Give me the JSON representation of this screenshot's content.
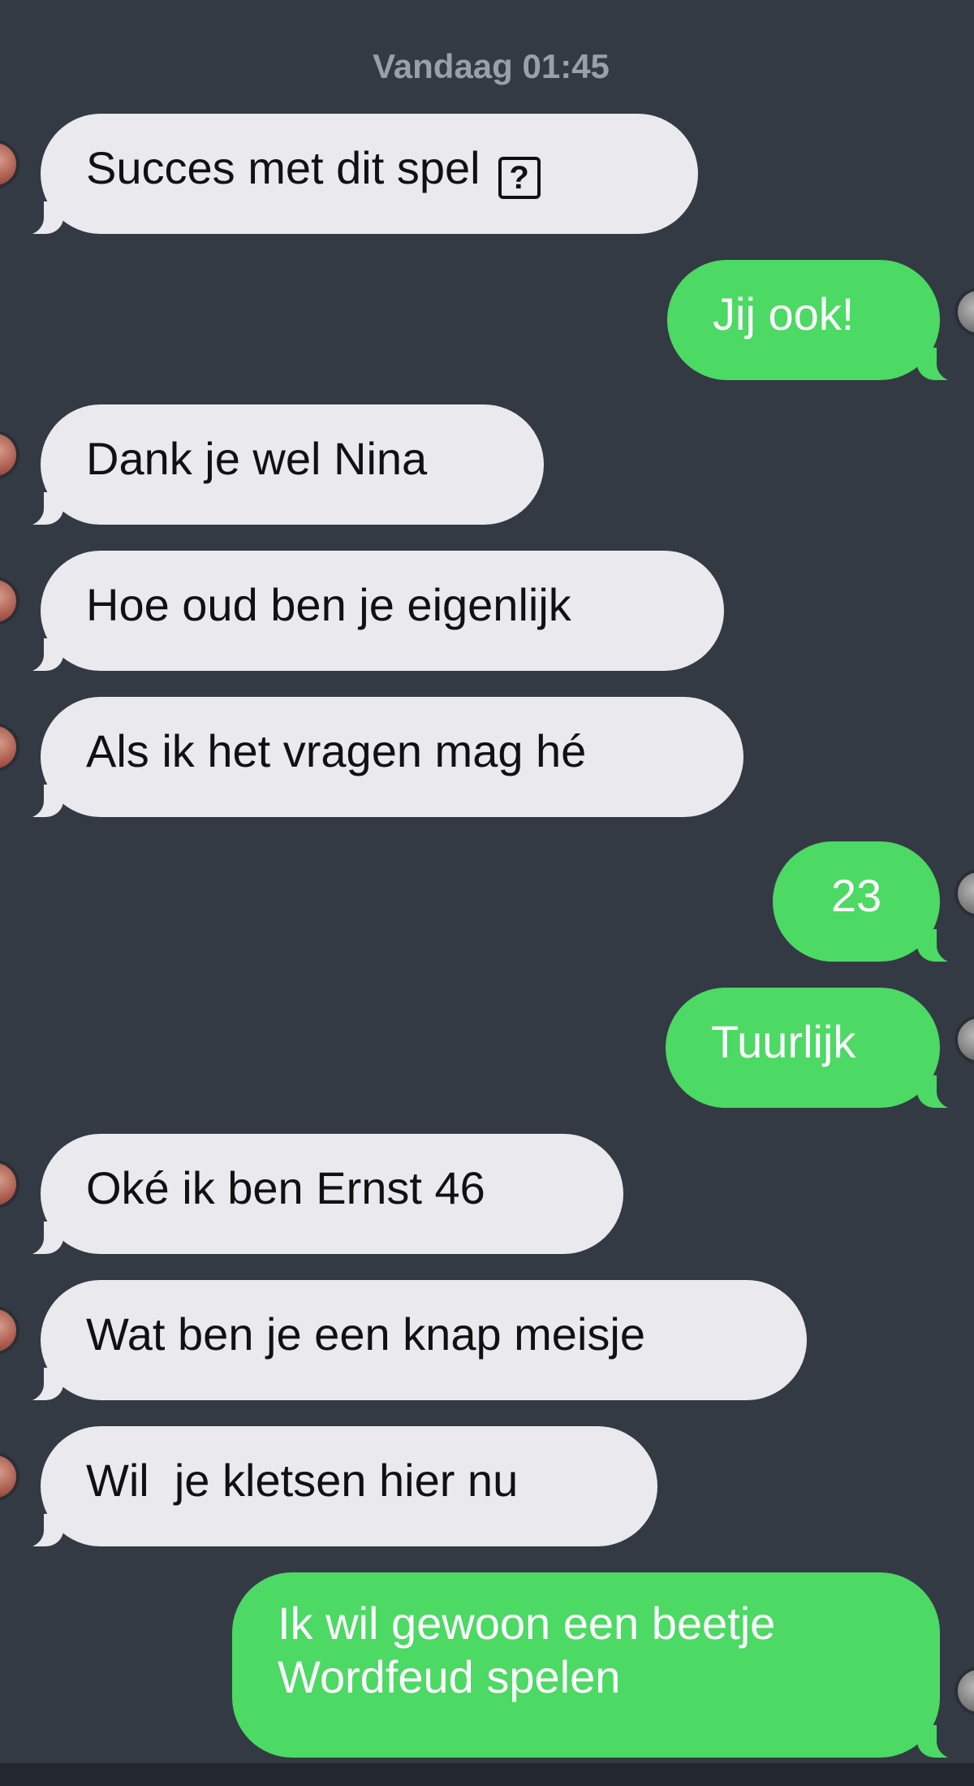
{
  "conversation": {
    "timestamp": "Vandaag 01:45",
    "messages": [
      {
        "sender": "incoming",
        "text": "Succes met dit spel",
        "icon": "?"
      },
      {
        "sender": "outgoing",
        "text": "Jij ook!"
      },
      {
        "sender": "incoming",
        "text": "Dank je wel Nina"
      },
      {
        "sender": "incoming",
        "text": "Hoe oud ben je eigenlijk"
      },
      {
        "sender": "incoming",
        "text": "Als ik het vragen mag hé"
      },
      {
        "sender": "outgoing",
        "text": "23"
      },
      {
        "sender": "outgoing",
        "text": "Tuurlijk"
      },
      {
        "sender": "incoming",
        "text": "Oké ik ben Ernst 46"
      },
      {
        "sender": "incoming",
        "text": "Wat ben je een knap meisje"
      },
      {
        "sender": "incoming",
        "text": "Wil  je kletsen hier nu"
      },
      {
        "sender": "outgoing",
        "text_lines": [
          "Ik wil gewoon een beetje",
          "Wordfeud spelen"
        ]
      }
    ]
  },
  "colors": {
    "background": "#343a44",
    "incoming_bubble": "#e9e9ee",
    "outgoing_bubble": "#4cd964",
    "timestamp_text": "#9aa0a8"
  }
}
